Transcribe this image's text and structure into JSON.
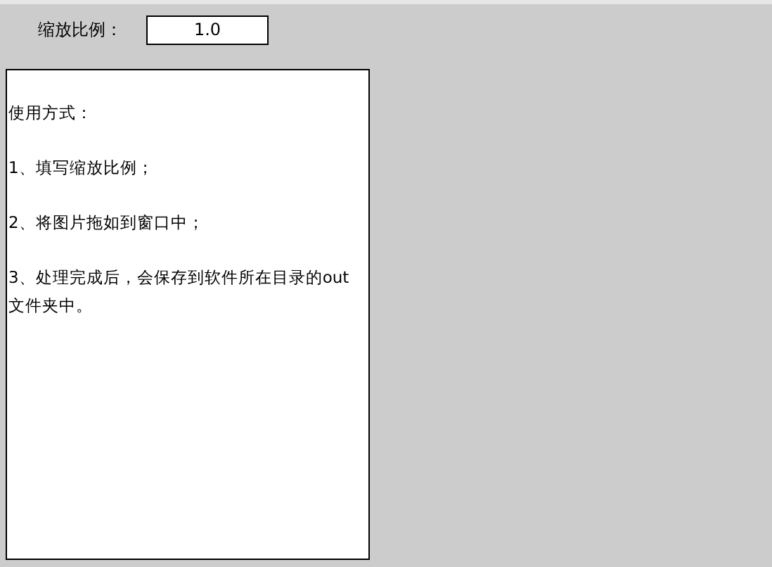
{
  "scale_field": {
    "label": "缩放比例：",
    "value": "1.0"
  },
  "instructions": {
    "heading": "使用方式：",
    "steps": [
      "1、填写缩放比例；",
      "2、将图片拖如到窗口中；",
      "3、处理完成后，会保存到软件所在目录的out文件夹中。"
    ]
  }
}
